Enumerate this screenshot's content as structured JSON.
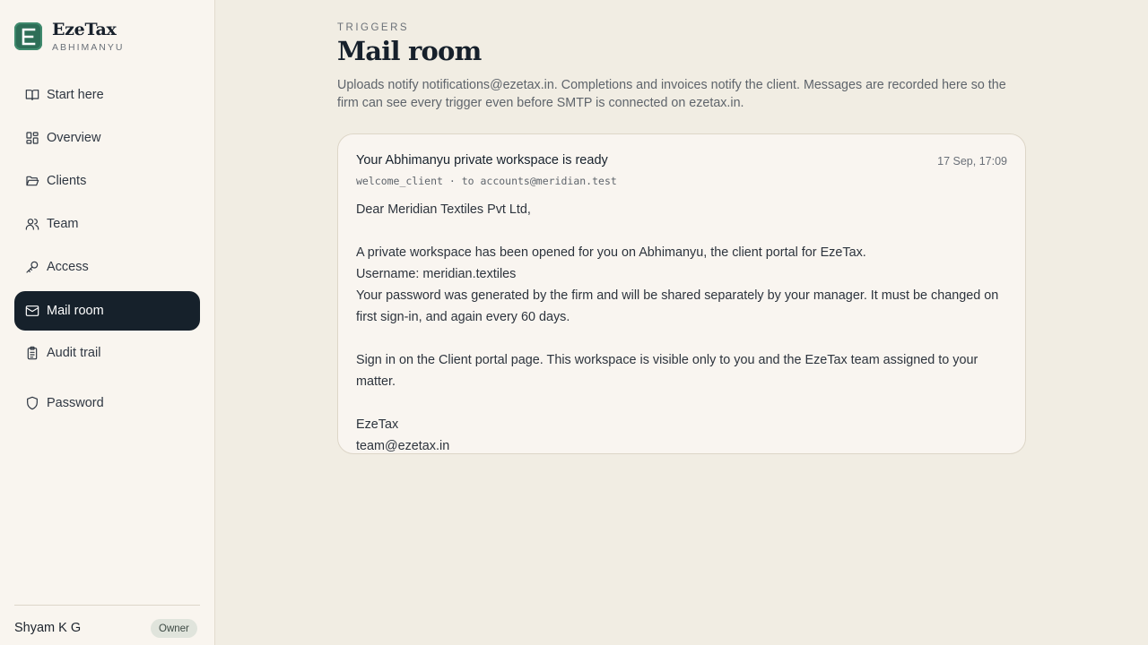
{
  "brand": {
    "logo_letter": "E",
    "name": "EzeTax",
    "subtitle": "ABHIMANYU",
    "color": "#2d6e57"
  },
  "sidebar": {
    "items": [
      {
        "label": "Start here",
        "icon": "book-open-icon",
        "active": false
      },
      {
        "label": "Overview",
        "icon": "dashboard-grid-icon",
        "active": false
      },
      {
        "label": "Clients",
        "icon": "folder-open-icon",
        "active": false
      },
      {
        "label": "Team",
        "icon": "users-icon",
        "active": false
      },
      {
        "label": "Access",
        "icon": "key-icon",
        "active": false
      },
      {
        "label": "Mail room",
        "icon": "mail-icon",
        "active": true
      },
      {
        "label": "Audit trail",
        "icon": "clipboard-list-icon",
        "active": false
      },
      {
        "label": "Password",
        "icon": "shield-icon",
        "active": false
      }
    ],
    "user": {
      "name": "Shyam K G",
      "role": "Owner"
    }
  },
  "page": {
    "eyebrow": "TRIGGERS",
    "title": "Mail room",
    "description": "Uploads notify notifications@ezetax.in. Completions and invoices notify the client. Messages are recorded here so the firm can see every trigger even before SMTP is connected on ezetax.in."
  },
  "mails": [
    {
      "subject": "Your Abhimanyu private workspace is ready",
      "timestamp": "17 Sep, 17:09",
      "meta": "welcome_client · to accounts@meridian.test",
      "body": "Dear Meridian Textiles Pvt Ltd,\n\nA private workspace has been opened for you on Abhimanyu, the client portal for EzeTax.\nUsername: meridian.textiles\nYour password was generated by the firm and will be shared separately by your manager. It must be changed on first sign-in, and again every 60 days.\n\nSign in on the Client portal page. This workspace is visible only to you and the EzeTax team assigned to your matter.\n\nEzeTax\nteam@ezetax.in"
    }
  ],
  "colors": {
    "accent": "#16212b",
    "background": "#f1ede3",
    "sidebar": "#f9f5ef"
  }
}
